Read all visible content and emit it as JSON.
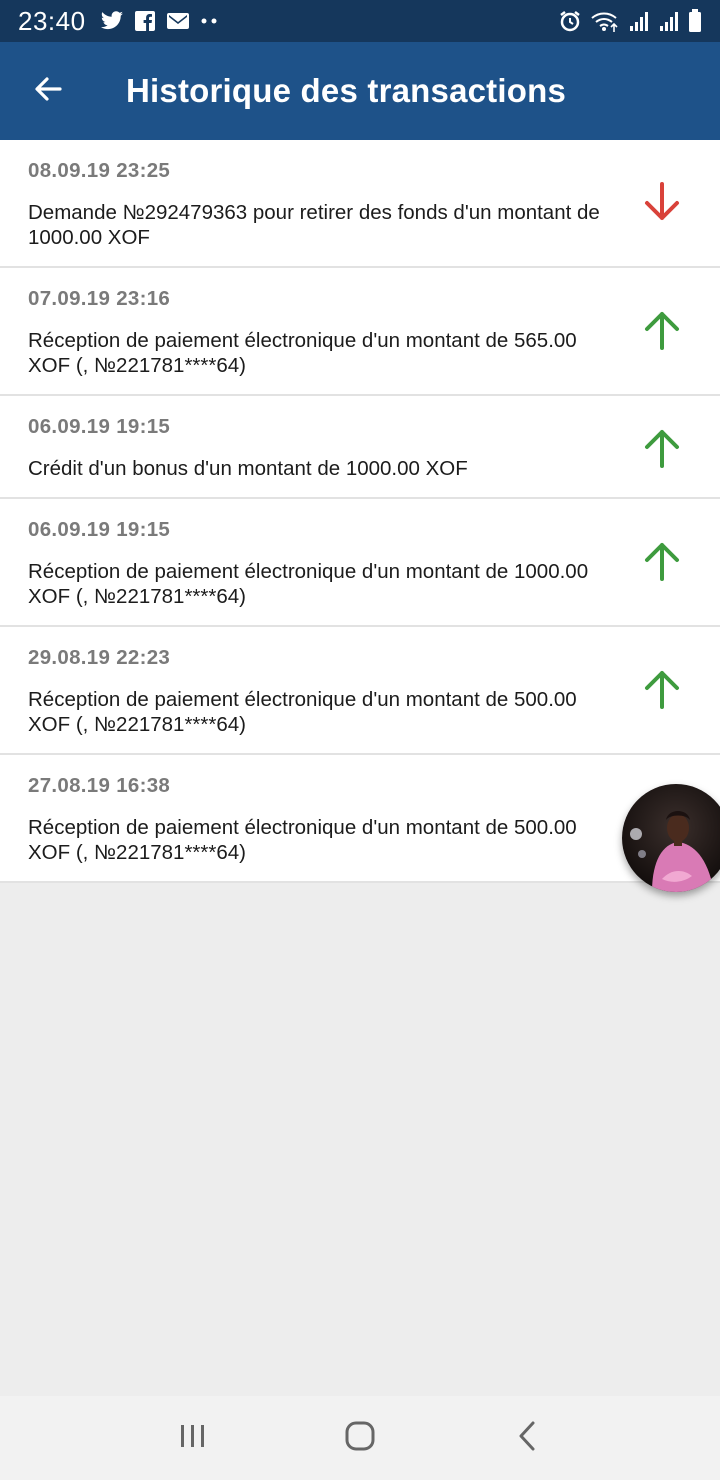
{
  "status_bar": {
    "time": "23:40",
    "left_icons": [
      "twitter-icon",
      "facebook-icon",
      "gmail-icon",
      "more-notifications-icon"
    ],
    "right_icons": [
      "alarm-icon",
      "wifi-icon",
      "signal-icon",
      "signal-icon",
      "battery-icon"
    ]
  },
  "app_bar": {
    "title": "Historique des transactions",
    "back_icon": "arrow-left-icon"
  },
  "colors": {
    "status_bar": "#15375c",
    "app_bar": "#1e5289",
    "arrow_down": "#d9423a",
    "arrow_up": "#3e9b3e",
    "date_text": "#7a7a7a"
  },
  "transactions": [
    {
      "date": "08.09.19 23:25",
      "description": "Demande №292479363 pour retirer des fonds d'un montant de 1000.00 XOF",
      "direction": "down"
    },
    {
      "date": "07.09.19 23:16",
      "description": "Réception de paiement électronique d'un montant de 565.00 XOF (,  №221781****64)",
      "direction": "up"
    },
    {
      "date": "06.09.19 19:15",
      "description": "Crédit d'un bonus d'un montant de 1000.00 XOF",
      "direction": "up"
    },
    {
      "date": "06.09.19 19:15",
      "description": "Réception de paiement électronique d'un montant de 1000.00 XOF (,  №221781****64)",
      "direction": "up"
    },
    {
      "date": "29.08.19 22:23",
      "description": "Réception de paiement électronique d'un montant de 500.00 XOF (,  №221781****64)",
      "direction": "up"
    },
    {
      "date": "27.08.19 16:38",
      "description": "Réception de paiement électronique d'un montant de 500.00 XOF (,  №221781****64)",
      "direction": "up"
    }
  ],
  "nav_bar": {
    "buttons": [
      "recent-apps-icon",
      "home-icon",
      "back-icon"
    ]
  }
}
